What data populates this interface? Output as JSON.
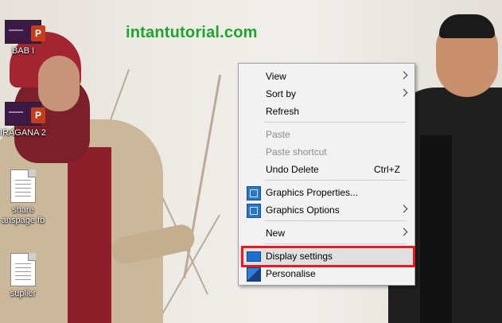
{
  "watermark": "intantutorial.com",
  "desktop_icons": [
    {
      "label": "BAB I"
    },
    {
      "label": "IRAGANA 2"
    },
    {
      "label_line1": "share",
      "label_line2": "anspage fb"
    },
    {
      "label": "suplier"
    }
  ],
  "context_menu": {
    "items": [
      {
        "label": "View"
      },
      {
        "label": "Sort by"
      },
      {
        "label": "Refresh"
      },
      {
        "label": "Paste"
      },
      {
        "label": "Paste shortcut"
      },
      {
        "label": "Undo Delete",
        "shortcut": "Ctrl+Z"
      },
      {
        "label": "Graphics Properties..."
      },
      {
        "label": "Graphics Options"
      },
      {
        "label": "New"
      },
      {
        "label": "Display settings"
      },
      {
        "label": "Personalise"
      }
    ]
  },
  "ppt_badge": "P",
  "colors": {
    "watermark": "#1aa52e",
    "highlight_box": "#e41b23",
    "menu_bg": "#f2f2f2"
  }
}
